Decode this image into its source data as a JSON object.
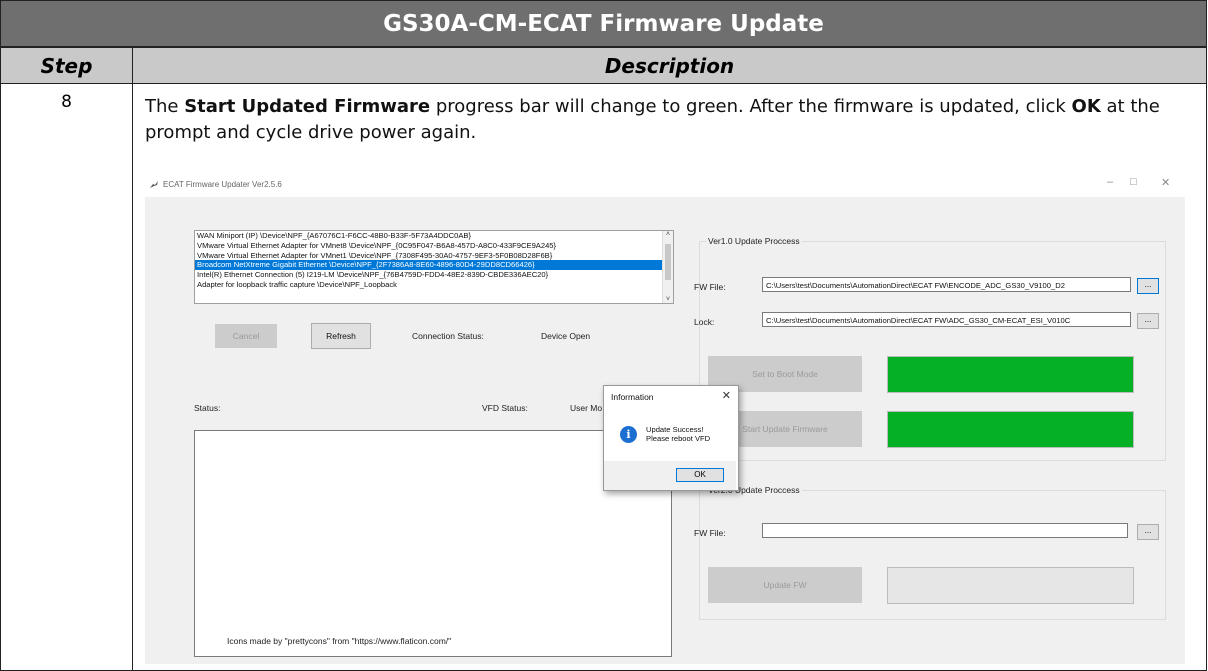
{
  "document": {
    "title": "GS30A-CM-ECAT Firmware Update",
    "col_step": "Step",
    "col_description": "Description",
    "step_number": "8",
    "desc_part1": "The ",
    "desc_bold1": "Start Updated Firmware",
    "desc_part2": " progress bar will change to green. After the firmware is updated, click ",
    "desc_bold2": "OK",
    "desc_part3": " at the prompt and cycle drive power again."
  },
  "app": {
    "window_title": "ECAT Firmware Updater Ver2.5.6",
    "window_controls": {
      "minimize": "–",
      "maximize": "□",
      "close": "✕"
    },
    "adapters": [
      "WAN Miniport (IP) \\Device\\NPF_{A67076C1-F6CC-48B0-B33F-5F73A4DDC0AB}",
      "VMware Virtual Ethernet Adapter for VMnet8 \\Device\\NPF_{0C95F047-B6A8-457D-A8C0-433F9CE9A245}",
      "VMware Virtual Ethernet Adapter for VMnet1 \\Device\\NPF_{7308F495-30A0-4757-9EF3-5F0B08D28F6B}",
      "Broadcom NetXtreme Gigabit Ethernet \\Device\\NPF_{2F7386A8-8E60-4896-80D4-29DD8CD66426}",
      "Intel(R) Ethernet Connection (5) I219-LM \\Device\\NPF_{76B4759D-FDD4-48E2-839D-CBDE336AEC20}",
      "Adapter for loopback traffic capture \\Device\\NPF_Loopback"
    ],
    "selected_adapter_index": 3,
    "cancel_label": "Cancel",
    "refresh_label": "Refresh",
    "connection_status_label": "Connection Status:",
    "connection_status_value": "Device Open",
    "status_label": "Status:",
    "vfd_status_label": "VFD Status:",
    "user_mode_label": "User Mo",
    "credits": "Icons made by \"prettycons\" from \"https://www.flaticon.com/\"",
    "v1": {
      "group_title": "Ver1.0 Update Proccess",
      "fw_file_label": "FW File:",
      "fw_file_value": "C:\\Users\\test\\Documents\\AutomationDirect\\ECAT FW\\ENCODE_ADC_GS30_V9100_D2",
      "lock_label": "Lock:",
      "lock_value": "C:\\Users\\test\\Documents\\AutomationDirect\\ECAT FW\\ADC_GS30_CM-ECAT_ESI_V010C",
      "browse_label": "...",
      "boot_mode_label": "Set to Boot Mode",
      "start_update_label": "Start Update Firmware",
      "boot_progress": 1.0,
      "update_progress": 1.0,
      "progress_color": "#06b025"
    },
    "v2": {
      "group_title": "Ver2.0 Update Proccess",
      "fw_file_label": "FW File:",
      "fw_file_value": "",
      "browse_label": "...",
      "update_fw_label": "Update FW",
      "update_progress": 0
    },
    "dialog": {
      "title": "Information",
      "close": "✕",
      "icon": "i",
      "message_line1": "Update Success!",
      "message_line2": "Please reboot VFD",
      "ok_label": "OK"
    }
  }
}
